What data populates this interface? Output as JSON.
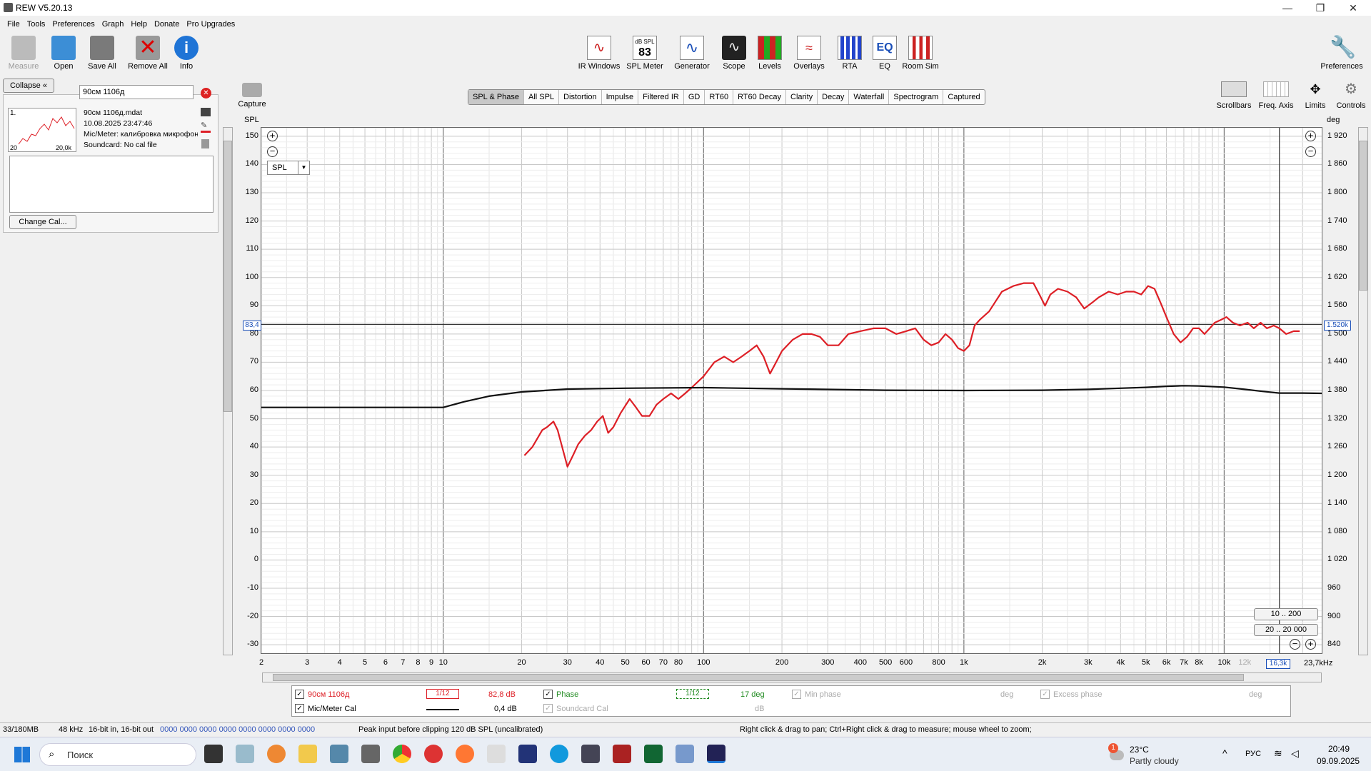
{
  "window": {
    "title": "REW V5.20.13"
  },
  "menu": [
    "File",
    "Tools",
    "Preferences",
    "Graph",
    "Help",
    "Donate",
    "Pro Upgrades"
  ],
  "toolbar_left": [
    {
      "label": "Measure",
      "icon": "measure-icon"
    },
    {
      "label": "Open",
      "icon": "folder-icon"
    },
    {
      "label": "Save All",
      "icon": "save-icon"
    },
    {
      "label": "Remove All",
      "icon": "remove-icon"
    },
    {
      "label": "Info",
      "icon": "info-icon"
    }
  ],
  "toolbar_center": [
    {
      "label": "IR Windows"
    },
    {
      "label": "SPL Meter",
      "badge": "83",
      "badge_top": "dB SPL"
    },
    {
      "label": "Generator"
    },
    {
      "label": "Scope"
    },
    {
      "label": "Levels"
    },
    {
      "label": "Overlays"
    },
    {
      "label": "RTA"
    },
    {
      "label": "EQ",
      "badge": "EQ"
    },
    {
      "label": "Room Sim"
    }
  ],
  "toolbar_right": {
    "label": "Preferences"
  },
  "capture": {
    "label": "Capture"
  },
  "right_tools": [
    "Scrollbars",
    "Freq. Axis",
    "Limits",
    "Controls"
  ],
  "left_panel": {
    "collapse_label": "Collapse",
    "search_value": "90см 1106д",
    "measurement": {
      "index": "1.",
      "file": "90см 1106д.mdat",
      "date": "10.08.2025 23:47:46",
      "mic": "Mic/Meter: калибровка микрофон",
      "sound": "Soundcard: No cal file",
      "thumb_left": "20",
      "thumb_right": "20,0k"
    },
    "change_cal_label": "Change Cal..."
  },
  "tabs": [
    "SPL & Phase",
    "All SPL",
    "Distortion",
    "Impulse",
    "Filtered IR",
    "GD",
    "RT60",
    "RT60 Decay",
    "Clarity",
    "Decay",
    "Waterfall",
    "Spectrogram",
    "Captured"
  ],
  "active_tab": "SPL & Phase",
  "axis_labels": {
    "left": "SPL",
    "right": "deg",
    "x_unit": "23,7kHz"
  },
  "spl_select": "SPL",
  "cursor": {
    "left": "83,4",
    "right": "1.520k",
    "x": "16,3k"
  },
  "range_buttons": [
    "10 .. 200",
    "20 .. 20 000"
  ],
  "legend": {
    "row1": {
      "name": "90см 1106д",
      "smoothing": "1/12",
      "value": "82,8 dB",
      "phase_label": "Phase",
      "phase_smoothing": "1/12",
      "phase_value": "17 deg",
      "min_phase": "Min phase",
      "min_phase_unit": "deg",
      "excess": "Excess phase",
      "excess_unit": "deg"
    },
    "row2": {
      "name": "Mic/Meter Cal",
      "value": "0,4 dB",
      "sc": "Soundcard Cal",
      "sc_unit": "dB"
    }
  },
  "status": {
    "mem": "33/180MB",
    "rate": "48 kHz",
    "bits": "16-bit in, 16-bit out",
    "bits_vals": "0000 0000  0000 0000  0000 0000  0000 0000",
    "peak": "Peak input before clipping 120 dB SPL (uncalibrated)",
    "hint": "Right click & drag to pan; Ctrl+Right click & drag to measure; mouse wheel to zoom;"
  },
  "taskbar": {
    "search": "Поиск",
    "weather_temp": "23°C",
    "weather_desc": "Partly cloudy",
    "lang": "РУС",
    "time": "20:49",
    "date": "09.09.2025",
    "badge": "1"
  },
  "colors": {
    "spl": "#dd1f26",
    "phase": "#111111",
    "grid": "#cfcfcf"
  },
  "chart_data": {
    "type": "line",
    "x_scale": "log",
    "xlim": [
      2,
      23700
    ],
    "ylim": [
      -33,
      153
    ],
    "y2lim": [
      829,
      1929
    ],
    "yticks": [
      150,
      140,
      130,
      120,
      110,
      100,
      90,
      80,
      70,
      60,
      50,
      40,
      30,
      20,
      10,
      0,
      -10,
      -20,
      -30
    ],
    "y2ticks": [
      "1 920",
      "1 860",
      "1 800",
      "1 740",
      "1 680",
      "1 620",
      "1 560",
      "1 500",
      "1 440",
      "1 380",
      "1 320",
      "1 260",
      "1 200",
      "1 140",
      "1 080",
      "1 020",
      "960",
      "900",
      "840"
    ],
    "xticks": [
      {
        "v": 2,
        "l": "2"
      },
      {
        "v": 3,
        "l": "3"
      },
      {
        "v": 4,
        "l": "4"
      },
      {
        "v": 5,
        "l": "5"
      },
      {
        "v": 6,
        "l": "6"
      },
      {
        "v": 7,
        "l": "7"
      },
      {
        "v": 8,
        "l": "8"
      },
      {
        "v": 9,
        "l": "9"
      },
      {
        "v": 10,
        "l": "10"
      },
      {
        "v": 20,
        "l": "20"
      },
      {
        "v": 30,
        "l": "30"
      },
      {
        "v": 40,
        "l": "40"
      },
      {
        "v": 50,
        "l": "50"
      },
      {
        "v": 60,
        "l": "60"
      },
      {
        "v": 70,
        "l": "70"
      },
      {
        "v": 80,
        "l": "80"
      },
      {
        "v": 100,
        "l": "100"
      },
      {
        "v": 200,
        "l": "200"
      },
      {
        "v": 300,
        "l": "300"
      },
      {
        "v": 400,
        "l": "400"
      },
      {
        "v": 500,
        "l": "500"
      },
      {
        "v": 600,
        "l": "600"
      },
      {
        "v": 800,
        "l": "800"
      },
      {
        "v": 1000,
        "l": "1k"
      },
      {
        "v": 2000,
        "l": "2k"
      },
      {
        "v": 3000,
        "l": "3k"
      },
      {
        "v": 4000,
        "l": "4k"
      },
      {
        "v": 5000,
        "l": "5k"
      },
      {
        "v": 6000,
        "l": "6k"
      },
      {
        "v": 7000,
        "l": "7k"
      },
      {
        "v": 8000,
        "l": "8k"
      },
      {
        "v": 10000,
        "l": "10k"
      },
      {
        "v": 12000,
        "l": "12k"
      }
    ],
    "series": [
      {
        "name": "90см 1106д",
        "color": "#dd1f26",
        "points": [
          [
            20.5,
            37
          ],
          [
            22,
            40
          ],
          [
            24,
            46
          ],
          [
            25,
            47
          ],
          [
            26.5,
            49
          ],
          [
            27.5,
            46
          ],
          [
            29,
            38
          ],
          [
            30,
            33
          ],
          [
            31.5,
            37
          ],
          [
            33,
            41
          ],
          [
            35,
            44
          ],
          [
            37,
            46
          ],
          [
            39,
            49
          ],
          [
            41,
            51
          ],
          [
            43,
            45
          ],
          [
            45,
            47
          ],
          [
            48,
            52
          ],
          [
            52,
            57
          ],
          [
            55,
            54
          ],
          [
            58,
            51
          ],
          [
            62,
            51
          ],
          [
            66,
            55
          ],
          [
            70,
            57
          ],
          [
            75,
            59
          ],
          [
            80,
            57
          ],
          [
            85,
            59
          ],
          [
            90,
            61
          ],
          [
            100,
            65
          ],
          [
            110,
            70
          ],
          [
            120,
            72
          ],
          [
            130,
            70
          ],
          [
            140,
            72
          ],
          [
            150,
            74
          ],
          [
            160,
            76
          ],
          [
            170,
            72
          ],
          [
            180,
            66
          ],
          [
            190,
            70
          ],
          [
            200,
            74
          ],
          [
            220,
            78
          ],
          [
            240,
            80
          ],
          [
            260,
            80
          ],
          [
            280,
            79
          ],
          [
            300,
            76
          ],
          [
            330,
            76
          ],
          [
            360,
            80
          ],
          [
            400,
            81
          ],
          [
            450,
            82
          ],
          [
            500,
            82
          ],
          [
            550,
            80
          ],
          [
            600,
            81
          ],
          [
            650,
            82
          ],
          [
            700,
            78
          ],
          [
            750,
            76
          ],
          [
            800,
            77
          ],
          [
            850,
            80
          ],
          [
            900,
            78
          ],
          [
            950,
            75
          ],
          [
            1000,
            74
          ],
          [
            1050,
            76
          ],
          [
            1100,
            83
          ],
          [
            1150,
            85
          ],
          [
            1250,
            88
          ],
          [
            1400,
            95
          ],
          [
            1550,
            97
          ],
          [
            1700,
            98
          ],
          [
            1850,
            98
          ],
          [
            1950,
            94
          ],
          [
            2050,
            90
          ],
          [
            2150,
            94
          ],
          [
            2300,
            96
          ],
          [
            2500,
            95
          ],
          [
            2700,
            93
          ],
          [
            2900,
            89
          ],
          [
            3100,
            91
          ],
          [
            3300,
            93
          ],
          [
            3600,
            95
          ],
          [
            3900,
            94
          ],
          [
            4200,
            95
          ],
          [
            4500,
            95
          ],
          [
            4800,
            94
          ],
          [
            5100,
            97
          ],
          [
            5400,
            96
          ],
          [
            5700,
            91
          ],
          [
            6000,
            86
          ],
          [
            6400,
            80
          ],
          [
            6800,
            77
          ],
          [
            7200,
            79
          ],
          [
            7600,
            82
          ],
          [
            8000,
            82
          ],
          [
            8400,
            80
          ],
          [
            8800,
            82
          ],
          [
            9200,
            84
          ],
          [
            9700,
            85
          ],
          [
            10200,
            86
          ],
          [
            10800,
            84
          ],
          [
            11500,
            83
          ],
          [
            12300,
            84
          ],
          [
            13000,
            82
          ],
          [
            13800,
            84
          ],
          [
            14600,
            82
          ],
          [
            15500,
            83
          ],
          [
            16300,
            82
          ],
          [
            17300,
            80
          ],
          [
            18500,
            81
          ],
          [
            19500,
            81
          ]
        ]
      },
      {
        "name": "Phase",
        "color": "#111111",
        "points": [
          [
            2,
            54
          ],
          [
            9,
            54
          ],
          [
            10,
            54
          ],
          [
            12,
            56
          ],
          [
            15,
            58
          ],
          [
            20,
            59.5
          ],
          [
            30,
            60.5
          ],
          [
            50,
            60.8
          ],
          [
            100,
            61
          ],
          [
            200,
            60.6
          ],
          [
            500,
            60.1
          ],
          [
            1000,
            60
          ],
          [
            2000,
            60.1
          ],
          [
            3000,
            60.4
          ],
          [
            4000,
            60.8
          ],
          [
            5000,
            61.1
          ],
          [
            6000,
            61.5
          ],
          [
            7000,
            61.7
          ],
          [
            8000,
            61.6
          ],
          [
            10000,
            61.2
          ],
          [
            12000,
            60.4
          ],
          [
            14000,
            59.7
          ],
          [
            16300,
            59.1
          ],
          [
            20000,
            59.1
          ],
          [
            23700,
            59
          ]
        ]
      }
    ]
  }
}
